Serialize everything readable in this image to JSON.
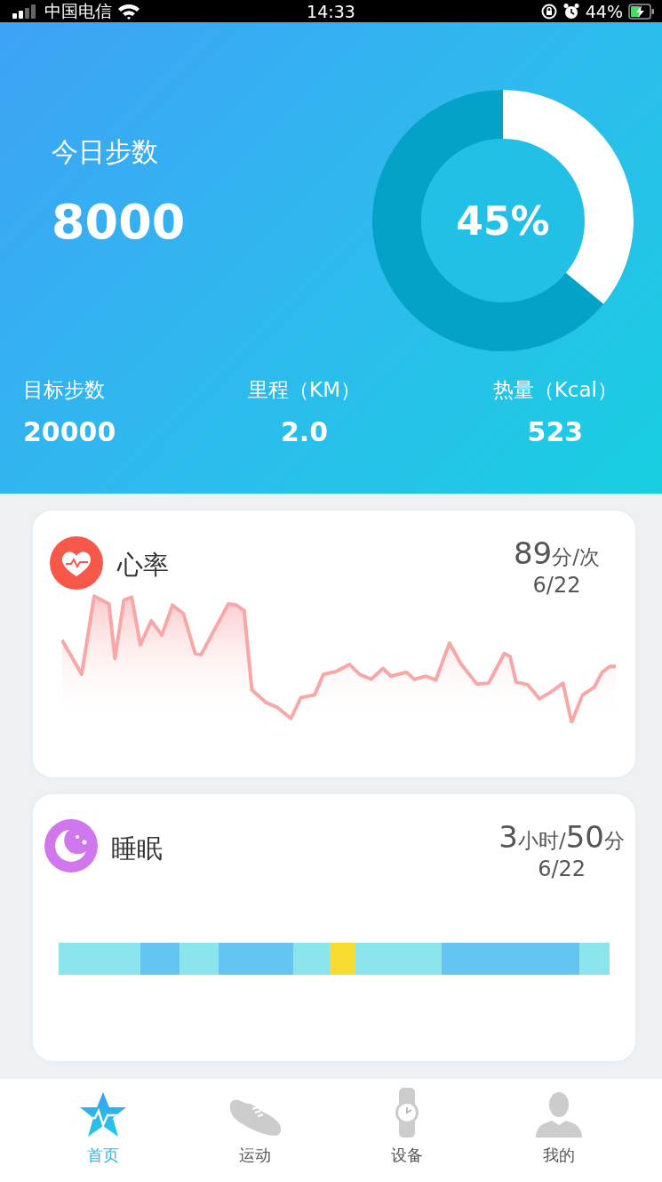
{
  "status_bar": {
    "carrier": "中国电信",
    "time": "14:33",
    "battery": "44%"
  },
  "steps": {
    "title": "今日步数",
    "value": "8000",
    "progress": {
      "reading": "45%",
      "level": 0.36
    }
  },
  "stats": [
    {
      "label": "目标步数",
      "value": "20000"
    },
    {
      "label": "里程（KM）",
      "value": "2.0"
    },
    {
      "label": "热量（Kcal）",
      "value": "523"
    }
  ],
  "cards": [
    {
      "kind": "heart",
      "title": "心率",
      "reading": [
        {
          "text": "89",
          "kind": "number"
        },
        {
          "text": "分/次",
          "kind": "unit"
        }
      ],
      "date": "6/22"
    },
    {
      "kind": "sleep",
      "title": "睡眠",
      "reading": [
        {
          "text": "3",
          "kind": "number"
        },
        {
          "text": "小时/",
          "kind": "unit"
        },
        {
          "text": "50",
          "kind": "number"
        },
        {
          "text": "分",
          "kind": "unit"
        }
      ],
      "date": "6/22",
      "segments": [
        {
          "color": "#8ce4ec"
        },
        {
          "color": "#64c4f2"
        },
        {
          "color": "#8ce4ec"
        },
        {
          "color": "#64c4f2"
        },
        {
          "color": "#8ce4ec"
        },
        {
          "color": "#f8dc30"
        },
        {
          "color": "#8ce4ec"
        },
        {
          "color": "#64c4f2"
        },
        {
          "color": "#8ce4ec"
        }
      ]
    }
  ],
  "tabs": [
    {
      "label": "首页",
      "kind": "home",
      "selected": true
    },
    {
      "label": "运动",
      "kind": "shoe",
      "selected": false
    },
    {
      "label": "设备",
      "kind": "watch",
      "selected": false
    },
    {
      "label": "我的",
      "kind": "person",
      "selected": false
    }
  ]
}
